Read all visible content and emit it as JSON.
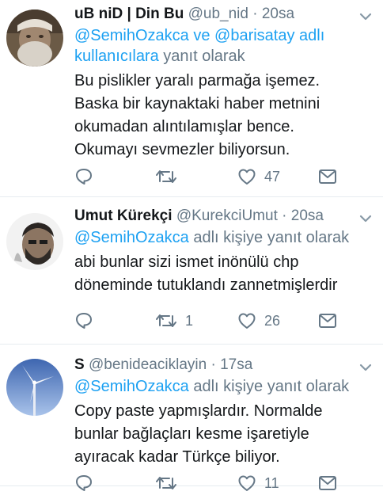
{
  "tweets": [
    {
      "name": "uB niD | Din Bu",
      "handle": "@ub_nid",
      "time": "20sa",
      "reply_mentions": "@SemihOzakca ve @barisatay adlı kullanıcılara",
      "reply_suffix": "yanıt olarak",
      "text": "Bu pislikler yaralı parmağa işemez. Baska bir kaynaktaki haber metnini okumadan alıntılamışlar bence. Okumayı sevmezler biliyorsun.",
      "retweets": "",
      "likes": "47"
    },
    {
      "name": "Umut Kürekçi",
      "handle": "@KurekciUmut",
      "time": "20sa",
      "reply_mentions": "@SemihOzakca",
      "reply_suffix": "adlı kişiye yanıt olarak",
      "text": "abi bunlar sizi ismet inönülü chp döneminde tutuklandı zannetmişlerdir",
      "retweets": "1",
      "likes": "26"
    },
    {
      "name": "S",
      "handle": "@benideaciklayin",
      "time": "17sa",
      "reply_mentions": "@SemihOzakca",
      "reply_suffix": "adlı kişiye yanıt olarak",
      "text": "Copy paste yapmışlardır. Normalde bunlar bağlaçları kesme işaretiyle ayıracak kadar Türkçe biliyor.",
      "retweets": "",
      "likes": "11"
    }
  ],
  "colors": {
    "link": "#1da1f2",
    "muted": "#657786",
    "text": "#14171a",
    "divider": "#e6ecf0"
  },
  "icons": [
    "reply-icon",
    "retweet-icon",
    "like-icon",
    "direct-message-icon",
    "chevron-down-icon"
  ]
}
